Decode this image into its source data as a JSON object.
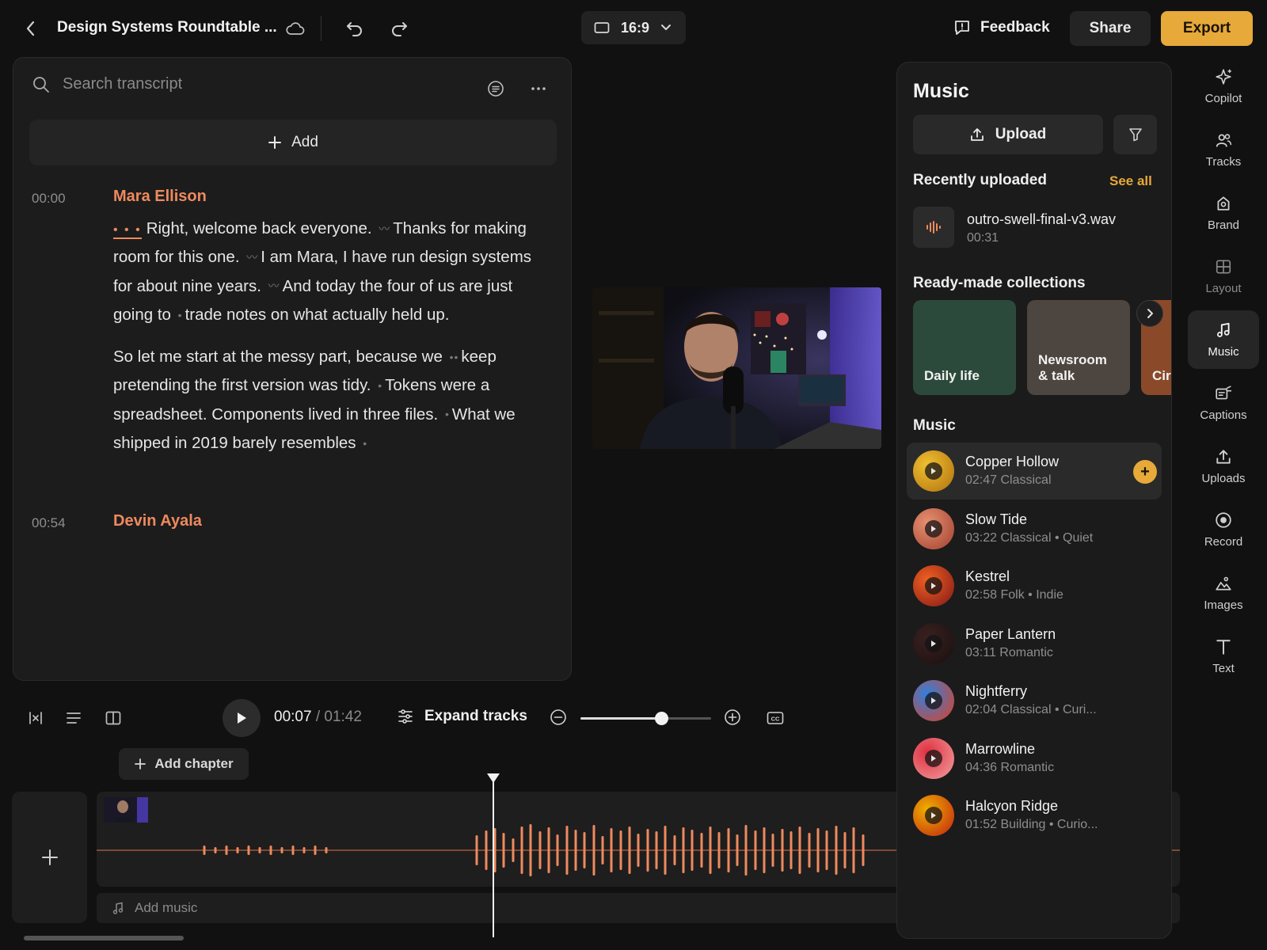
{
  "header": {
    "project_title": "Design Systems Roundtable ...",
    "aspect_ratio": "16:9",
    "feedback_label": "Feedback",
    "share_label": "Share",
    "export_label": "Export",
    "accent_color": "#e6a93a"
  },
  "transcript": {
    "search_placeholder": "Search transcript",
    "add_label": "Add",
    "blocks": [
      {
        "time": "00:00",
        "speaker": "Mara Ellison",
        "paragraphs": [
          [
            "Right, welcome back everyone.",
            "Thanks for making room for this one.",
            "I am Mara, I have run design systems for about nine years.",
            "And today the four of us are just going to",
            "trade notes on what actually held up."
          ],
          [
            "So let me start at the messy part, because we",
            "keep pretending the first version was tidy.",
            "Tokens were a spreadsheet. Components lived in three files.",
            "What we shipped in 2019 barely resembles"
          ]
        ]
      },
      {
        "time": "00:54",
        "speaker": "Devin Ayala"
      }
    ],
    "speaker_color": "#ee8a5e"
  },
  "playback": {
    "current": "00:07",
    "separator": " / ",
    "total": "01:42",
    "expand_tracks_label": "Expand tracks",
    "zoom_level": 0.62,
    "add_chapter_label": "Add chapter",
    "add_music_label": "Add music"
  },
  "music_panel": {
    "title": "Music",
    "upload_label": "Upload",
    "recent_heading": "Recently uploaded",
    "see_all_label": "See all",
    "recent_file": {
      "name": "outro-swell-final-v3.wav",
      "duration": "00:31"
    },
    "collections_heading": "Ready-made collections",
    "collections": [
      {
        "label": "Daily life",
        "color": "#2c4a3c"
      },
      {
        "label": "Newsroom & talk",
        "color": "#4d4540"
      },
      {
        "label": "Cir",
        "color": "#8a4a2a"
      }
    ],
    "music_heading": "Music",
    "songs": [
      {
        "name": "Copper Hollow",
        "meta": "02:47 Classical",
        "colors": [
          "#f0c030",
          "#b07010"
        ],
        "active": true
      },
      {
        "name": "Slow Tide",
        "meta": "03:22 Classical • Quiet",
        "colors": [
          "#e89070",
          "#a04030"
        ]
      },
      {
        "name": "Kestrel",
        "meta": "02:58 Folk • Indie",
        "colors": [
          "#f06020",
          "#801818"
        ]
      },
      {
        "name": "Paper Lantern",
        "meta": "03:11 Romantic",
        "colors": [
          "#3a2020",
          "#1a1010"
        ]
      },
      {
        "name": "Nightferry",
        "meta": "02:04 Classical • Curi...",
        "colors": [
          "#3080e0",
          "#e04020"
        ]
      },
      {
        "name": "Marrowline",
        "meta": "04:36 Romantic",
        "colors": [
          "#e03040",
          "#f0a0a0"
        ]
      },
      {
        "name": "Halcyon Ridge",
        "meta": "01:52 Building • Curio...",
        "colors": [
          "#f0b000",
          "#c02010"
        ]
      }
    ]
  },
  "rail": [
    {
      "label": "Copilot",
      "icon": "sparkle-icon"
    },
    {
      "label": "Tracks",
      "icon": "people-icon"
    },
    {
      "label": "Brand",
      "icon": "brand-icon"
    },
    {
      "label": "Layout",
      "icon": "layout-icon"
    },
    {
      "label": "Music",
      "icon": "music-note-icon",
      "active": true
    },
    {
      "label": "Captions",
      "icon": "captions-icon"
    },
    {
      "label": "Uploads",
      "icon": "upload-icon"
    },
    {
      "label": "Record",
      "icon": "record-icon"
    },
    {
      "label": "Images",
      "icon": "image-icon"
    },
    {
      "label": "Text",
      "icon": "text-icon"
    }
  ]
}
